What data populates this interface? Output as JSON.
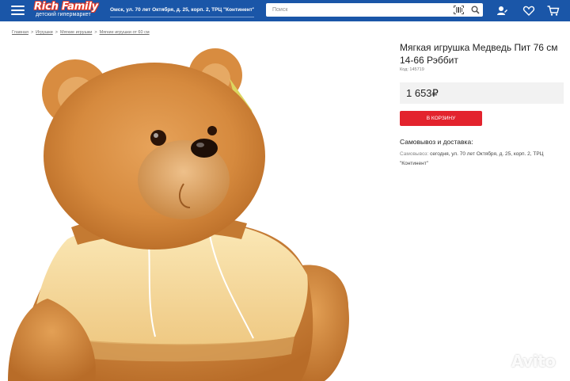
{
  "header": {
    "logo_main": "Rich Family",
    "logo_sub": "детский гипермаркет",
    "address": "Омск, ул. 70 лет Октября, д. 25, корп. 2, ТРЦ \"Континент\"",
    "search_placeholder": "Поиск"
  },
  "breadcrumb": [
    "Главная",
    "Игрушки",
    "Мягкие игрушки",
    "Мягкие игрушки от 60 см"
  ],
  "product": {
    "title": "Мягкая игрушка Медведь Пит 76 см 14-66 Рэббит",
    "code": "Код: 145719",
    "price": "1 653₽",
    "cart_button": "В КОРЗИНУ",
    "delivery_heading": "Самовывоз и доставка:",
    "delivery_label": "Самовывоз:",
    "delivery_text": "сегодня, ул. 70 лет Октября, д. 25, корп. 2, ТРЦ \"Континент\""
  },
  "watermark": "Avito",
  "colors": {
    "header_bg": "#1a56a8",
    "accent_red": "#e3232d",
    "price_bg": "#f2f2f2"
  },
  "icons": [
    "menu-icon",
    "barcode-icon",
    "search-icon",
    "profile-icon",
    "heart-icon",
    "cart-icon",
    "avito-logo-icon"
  ]
}
